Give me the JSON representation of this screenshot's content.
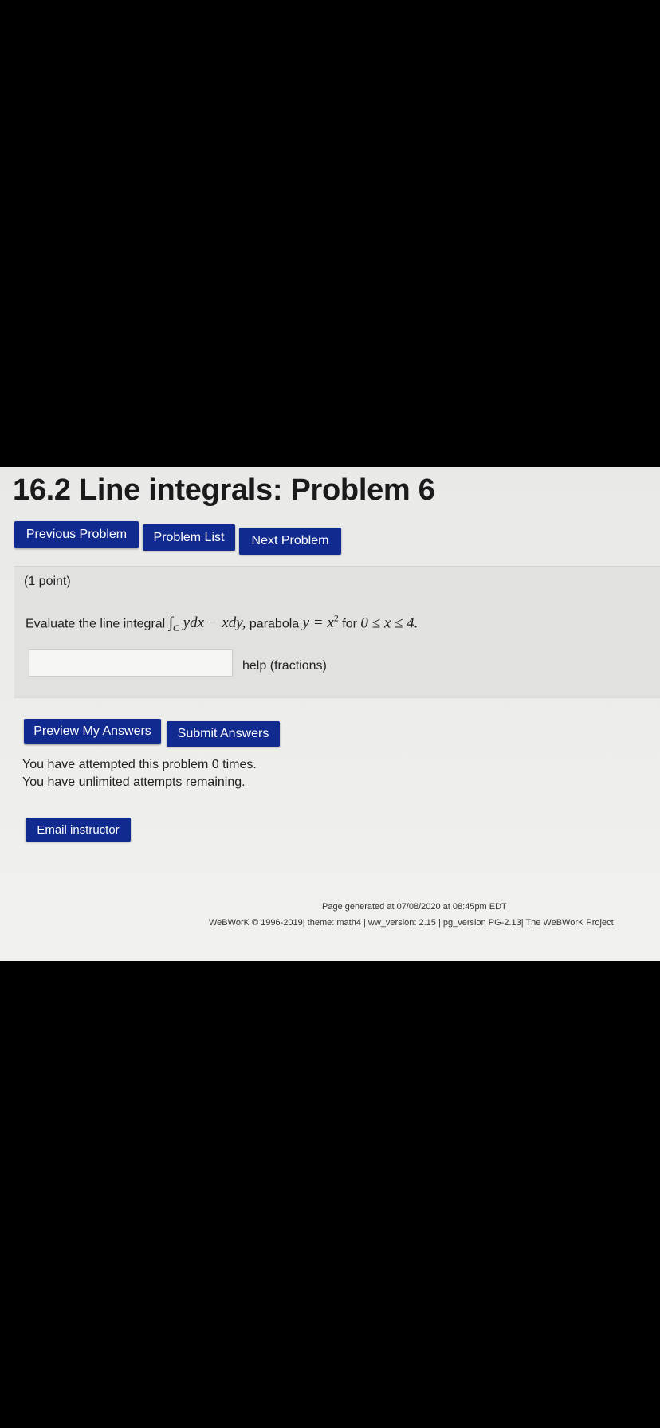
{
  "page": {
    "title": "16.2 Line integrals: Problem 6"
  },
  "nav": {
    "previous_label": "Previous Problem",
    "list_label": "Problem List",
    "next_label": "Next Problem"
  },
  "problem": {
    "points": "(1 point)",
    "prompt_prefix": "Evaluate the line integral",
    "integral_symbol": "∫",
    "integral_subscript": "C",
    "integrand": "ydx − xdy,",
    "curve_label": "parabola",
    "equation_lhs": "y = x",
    "equation_exponent": "2",
    "range_word": "for",
    "range": "0 ≤ x ≤ 4.",
    "answer_value": "",
    "help_link": "help (fractions)"
  },
  "actions": {
    "preview_label": "Preview My Answers",
    "submit_label": "Submit Answers"
  },
  "status": {
    "attempts_line": "You have attempted this problem 0 times.",
    "remaining_line": "You have unlimited attempts remaining."
  },
  "email": {
    "label": "Email instructor"
  },
  "footer": {
    "generated": "Page generated at 07/08/2020 at 08:45pm EDT",
    "credits": "WeBWorK © 1996-2019| theme: math4 | ww_version: 2.15 | pg_version PG-2.13| The WeBWorK Project"
  },
  "colors": {
    "button_bg": "#112a8f",
    "button_text": "#ffffff",
    "background": "#000000"
  }
}
